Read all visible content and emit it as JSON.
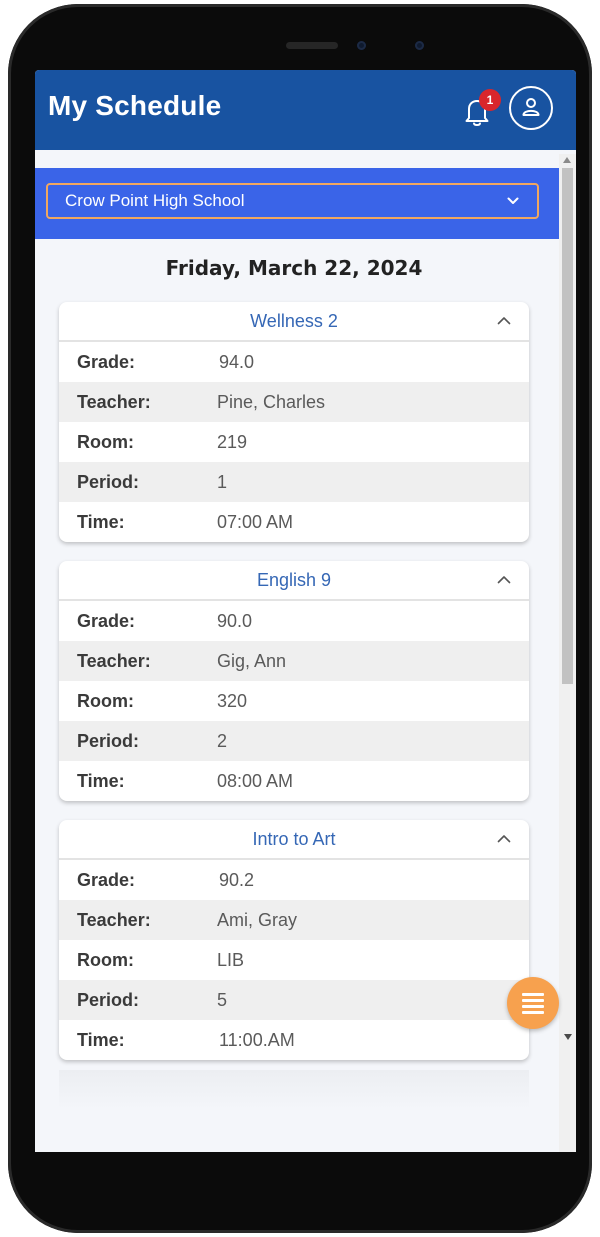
{
  "header": {
    "title": "My Schedule",
    "notification_count": "1"
  },
  "school_select": {
    "value": "Crow Point High School"
  },
  "date": "Friday, March 22, 2024",
  "courses": [
    {
      "name": "Wellness 2",
      "rows": [
        {
          "label": "Grade:",
          "value": "94.0"
        },
        {
          "label": "Teacher:",
          "value": "Pine, Charles"
        },
        {
          "label": "Room:",
          "value": "219"
        },
        {
          "label": "Period:",
          "value": "1"
        },
        {
          "label": "Time:",
          "value": "07:00 AM"
        }
      ]
    },
    {
      "name": "English 9",
      "rows": [
        {
          "label": "Grade:",
          "value": "90.0"
        },
        {
          "label": "Teacher:",
          "value": "Gig, Ann"
        },
        {
          "label": "Room:",
          "value": "320"
        },
        {
          "label": "Period:",
          "value": "2"
        },
        {
          "label": "Time:",
          "value": "08:00 AM"
        }
      ]
    },
    {
      "name": "Intro to Art",
      "rows": [
        {
          "label": "Grade:",
          "value": "90.2"
        },
        {
          "label": "Teacher:",
          "value": "Ami, Gray"
        },
        {
          "label": "Room:",
          "value": "LIB"
        },
        {
          "label": "Period:",
          "value": "5"
        },
        {
          "label": "Time:",
          "value": "11:00.AM"
        }
      ]
    }
  ],
  "icons": {
    "notification": "bell-icon",
    "profile": "user-icon",
    "dropdown": "chevron-down-icon",
    "collapse": "chevron-up-icon",
    "fab": "menu-icon"
  },
  "colors": {
    "header": "#1853a1",
    "select_band": "#3a64e8",
    "select_border": "#f0a760",
    "course_title": "#3567b5",
    "badge": "#d9262c",
    "fab": "#f7a14e"
  }
}
